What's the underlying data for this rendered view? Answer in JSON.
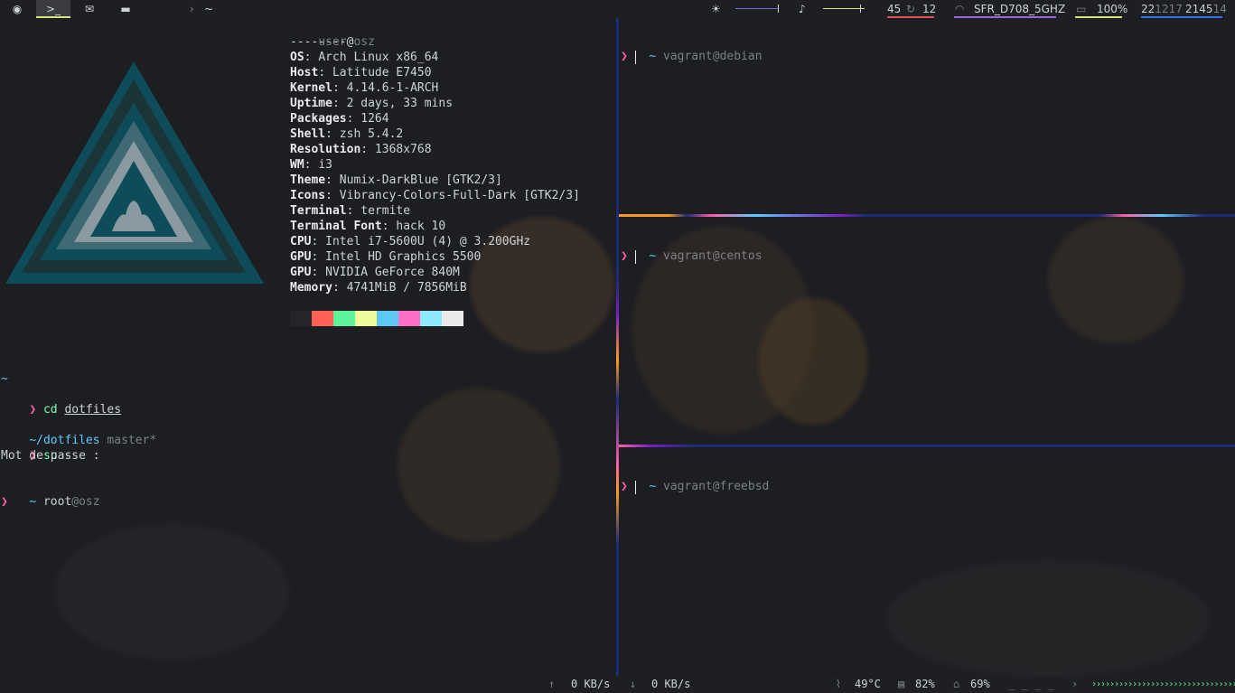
{
  "topbar": {
    "workspaces": [
      {
        "icon": "globe-icon",
        "glyph": "◉"
      },
      {
        "icon": "terminal-icon",
        "glyph": ">_"
      },
      {
        "icon": "mail-icon",
        "glyph": "✉"
      },
      {
        "icon": "chat-icon",
        "glyph": "▬"
      }
    ],
    "path_arrow": "›",
    "path": "~",
    "brightness_icon": "☀",
    "volume_icon": "♪",
    "updates_count": "45",
    "updates_icon": "↻",
    "updates_pending": "12",
    "wifi_icon": "◠",
    "wifi_ssid": "SFR_D708_5GHZ",
    "battery_icon": "▭",
    "battery": "100%",
    "date_a": "22",
    "date_b": "12",
    "date_c": "17",
    "time_a": "21",
    "time_b": "45",
    "time_c": "14",
    "accent_updates": "#e64f4f",
    "accent_wifi": "#9a67e0",
    "accent_battery": "#d5e07f",
    "accent_clock": "#2f6fe8"
  },
  "neofetch": {
    "user": "user",
    "at": "@",
    "host": "osz",
    "separator": "--------",
    "rows": [
      {
        "key": "OS",
        "value": "Arch Linux x86_64"
      },
      {
        "key": "Host",
        "value": "Latitude E7450"
      },
      {
        "key": "Kernel",
        "value": "4.14.6-1-ARCH"
      },
      {
        "key": "Uptime",
        "value": "2 days, 33 mins"
      },
      {
        "key": "Packages",
        "value": "1264"
      },
      {
        "key": "Shell",
        "value": "zsh 5.4.2"
      },
      {
        "key": "Resolution",
        "value": "1368x768"
      },
      {
        "key": "WM",
        "value": "i3"
      },
      {
        "key": "Theme",
        "value": "Numix-DarkBlue [GTK2/3]"
      },
      {
        "key": "Icons",
        "value": "Vibrancy-Colors-Full-Dark [GTK2/3]"
      },
      {
        "key": "Terminal",
        "value": "termite"
      },
      {
        "key": "Terminal Font",
        "value": "hack 10"
      },
      {
        "key": "CPU",
        "value": "Intel i7-5600U (4) @ 3.200GHz"
      },
      {
        "key": "GPU",
        "value": "Intel HD Graphics 5500"
      },
      {
        "key": "GPU",
        "value": "NVIDIA GeForce 840M"
      },
      {
        "key": "Memory",
        "value": "4741MiB / 7856MiB"
      }
    ],
    "palette": [
      "#25262b",
      "#ff6159",
      "#5ef39a",
      "#eff89a",
      "#5bc8f5",
      "#ff6fc5",
      "#8ee9fd",
      "#eaeaea"
    ]
  },
  "terminal_left": {
    "tilde1": "~",
    "prompt_symbol": "❯",
    "cmd1": "cd",
    "cmd1_arg": "dotfiles",
    "cwd2": "~/dotfiles",
    "branch": "master*",
    "cmd2": "su",
    "cmd2_arg": "-",
    "password_prompt": "Mot de passe :",
    "tilde3": "~",
    "root_user": "root",
    "root_host": "@osz"
  },
  "panes": [
    {
      "tilde": "~",
      "host": "vagrant@debian",
      "prompt": "❯"
    },
    {
      "tilde": "~",
      "host": "vagrant@centos",
      "prompt": "❯"
    },
    {
      "tilde": "~",
      "host": "vagrant@freebsd",
      "prompt": "❯"
    }
  ],
  "botbar": {
    "up_icon": "↑",
    "upload": "0 KB/s",
    "down_icon": "↓",
    "download": "0 KB/s",
    "temp_icon": "⌇",
    "temperature": "49°C",
    "disk_icon": "▤",
    "disk": "82%",
    "home_icon": "⌂",
    "home": "69%",
    "placeholders": "_ _ _ _",
    "arrow": "›",
    "progress": "››››››››››››››››››››››››››››››››"
  }
}
